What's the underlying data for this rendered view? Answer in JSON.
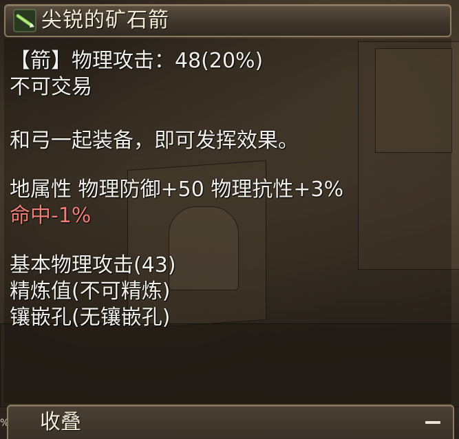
{
  "item": {
    "icon": "arrow-icon",
    "name": "尖锐的矿石箭"
  },
  "lines": {
    "attack": "【箭】物理攻击：48(20%)",
    "trade": "不可交易",
    "equip_note": "和弓一起装备，即可发挥效果。",
    "element_stats": "地属性 物理防御+50 物理抗性+3%",
    "hit_penalty": "命中-1%",
    "base_attack": "基本物理攻击(43)",
    "refine": "精炼值(不可精炼)",
    "sockets": "镶嵌孔(无镶嵌孔)"
  },
  "footer": {
    "collapse_label": "收叠",
    "collapse_icon": "minus-icon"
  },
  "edge_text": "%",
  "colors": {
    "text_main": "#f2f0ea",
    "text_negative": "#f07f78",
    "frame_border": "#8e7a5e",
    "icon_green": "#5fae3a"
  }
}
